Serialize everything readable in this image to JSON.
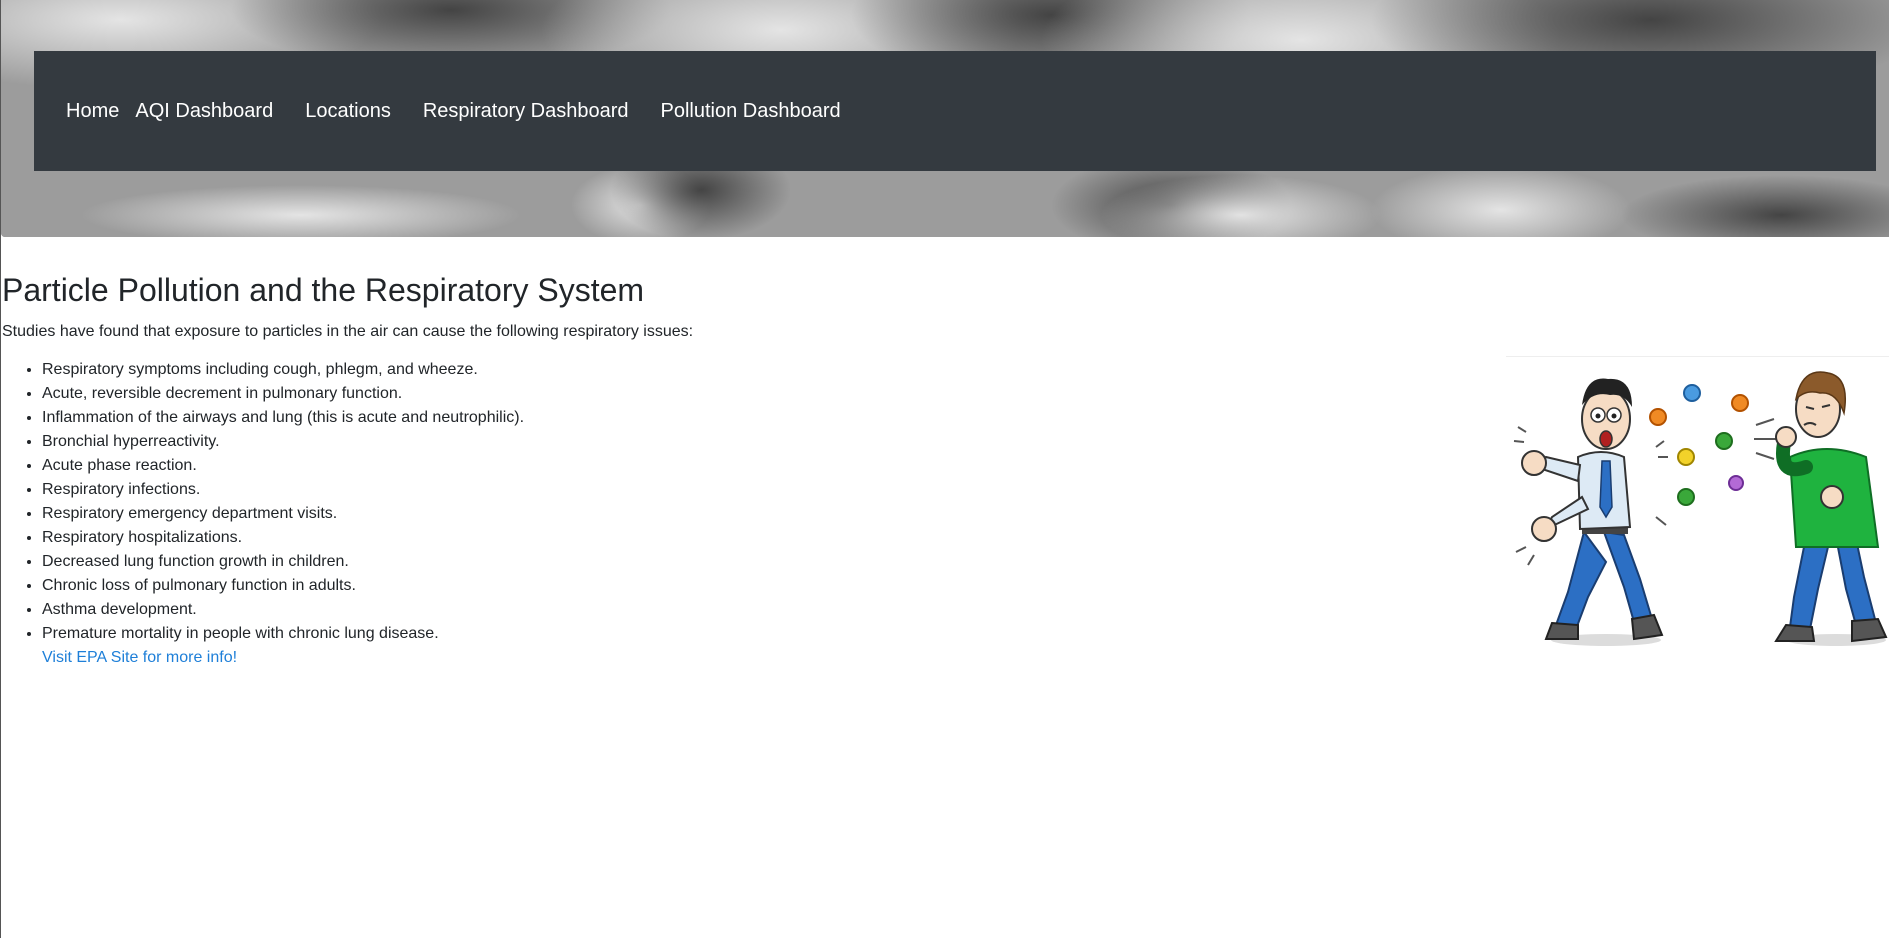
{
  "nav": {
    "items": [
      {
        "label": "Home"
      },
      {
        "label": "AQI Dashboard"
      },
      {
        "label": "Locations"
      },
      {
        "label": "Respiratory Dashboard"
      },
      {
        "label": "Pollution Dashboard"
      }
    ]
  },
  "main": {
    "title": "Particle Pollution and the Respiratory System",
    "intro": "Studies have found that exposure to particles in the air can cause the following respiratory issues:",
    "issues": [
      "Respiratory symptoms including cough, phlegm, and wheeze.",
      "Acute, reversible decrement in pulmonary function.",
      "Inflammation of the airways and lung (this is acute and neutrophilic).",
      "Bronchial hyperreactivity.",
      "Acute phase reaction.",
      "Respiratory infections.",
      "Respiratory emergency department visits.",
      "Respiratory hospitalizations.",
      "Decreased lung function growth in children.",
      "Chronic loss of pulmonary function in adults.",
      "Asthma development.",
      "Premature mortality in people with chronic lung disease."
    ],
    "link_text": "Visit EPA Site for more info!"
  },
  "colors": {
    "navbar_bg": "#343a40",
    "link": "#1e7fd8",
    "text": "#212529"
  },
  "icons": {
    "banner": "smokestack-clouds-image",
    "illustration": "coughing-man-germs-illustration"
  }
}
